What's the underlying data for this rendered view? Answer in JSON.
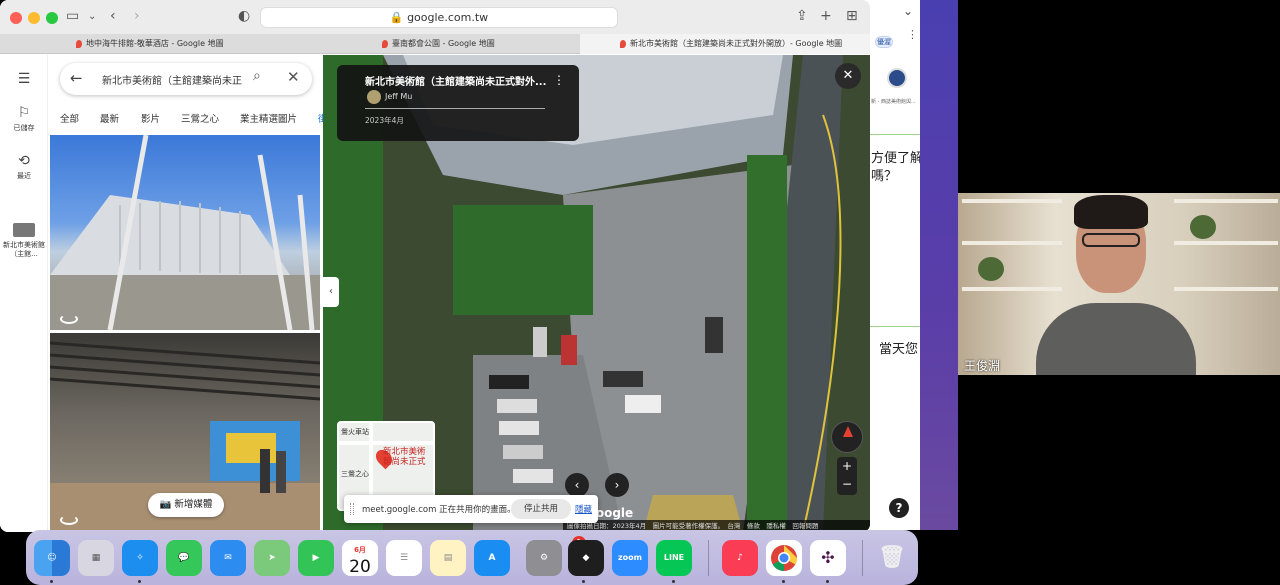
{
  "browser": {
    "url": "google.com.tw",
    "tabs": [
      {
        "title": "地中海牛排館-敬華酒店 - Google 地圖"
      },
      {
        "title": "臺南都會公園 - Google 地圖"
      },
      {
        "title": "新北市美術館（主館建築尚未正式對外開放）- Google 地圖"
      }
    ]
  },
  "maps": {
    "rail": {
      "saved_label": "已儲存",
      "recent_label": "最近",
      "place_label": "新北市美術館（主館..."
    },
    "search": {
      "query": "新北市美術館（主館建築尚未正"
    },
    "chips": [
      "全部",
      "最新",
      "影片",
      "三鶯之心",
      "業主精選圖片",
      "街"
    ],
    "add_media_label": "新增媒體",
    "info_card": {
      "title": "新北市美術館（主館建築尚未正式對外...",
      "author": "Jeff Mu",
      "date": "2023年4月"
    },
    "minimap": {
      "label_station": "鶯火車站",
      "label_place": "新北市美術館尚未正式",
      "label_heart": "三鶯之心"
    },
    "footer_text": "圖像拍攝日期：2023年4月　圖片可能受著作權保護。　台灣　條款　隱私權　回報問題",
    "google_logo": "Google"
  },
  "meet_share": {
    "message": "meet.google.com 正在共用你的畫面。",
    "stop_label": "停止共用",
    "hide_label": "隱藏"
  },
  "doc": {
    "chip": "優渥",
    "tiny": "新 - 西誌美術館與...",
    "question_line1": "方便了解",
    "question_line2": "嗎？",
    "question2": "當天您"
  },
  "webcam": {
    "participant_name": "王俊淵"
  },
  "dock": {
    "calendar_month": "6月",
    "calendar_day": "20",
    "settings_badge": "1",
    "zoom_label": "zoom",
    "line_label": "LINE"
  },
  "colors": {
    "maps_accent": "#1a73e8",
    "dock_bg": "#c2bde2",
    "purple_wallpaper": "#4a3fb0"
  }
}
